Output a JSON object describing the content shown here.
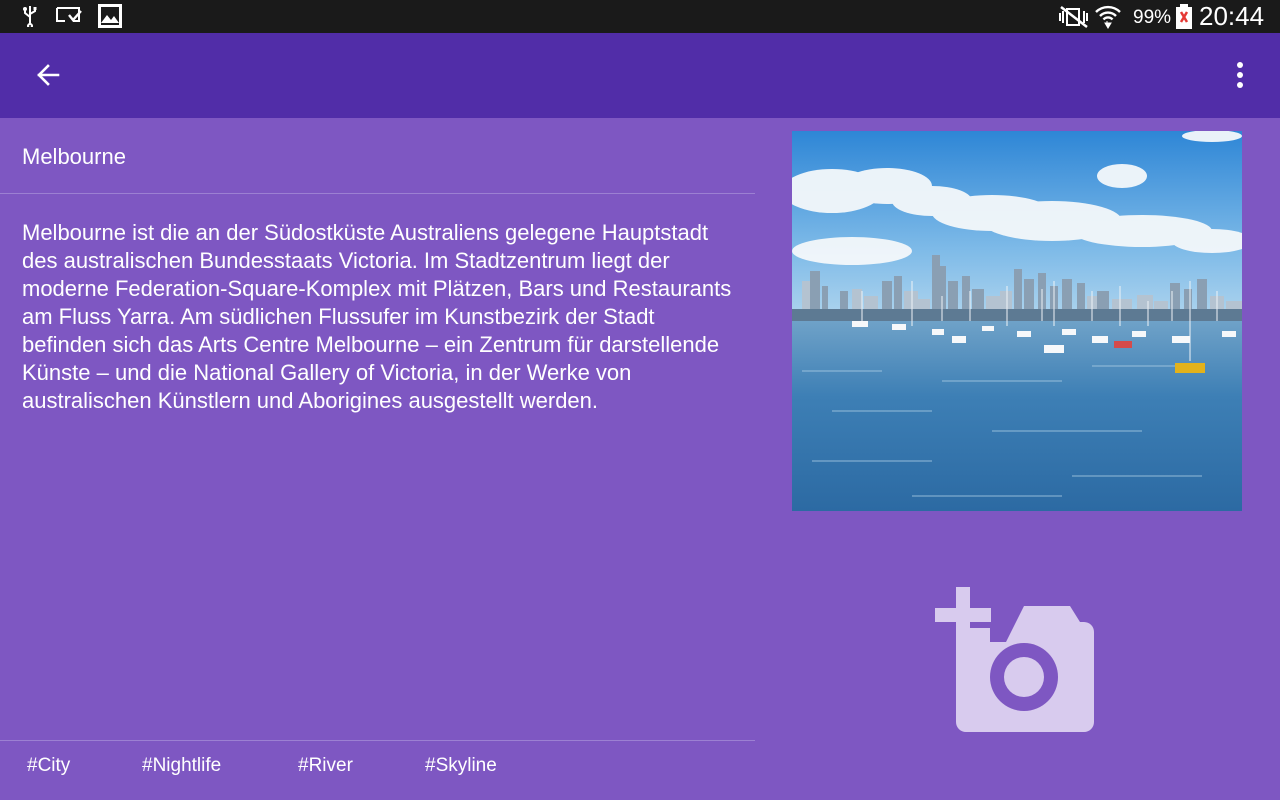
{
  "status_bar": {
    "battery_percent": "99%",
    "time": "20:44"
  },
  "place": {
    "title": "Melbourne",
    "description": "Melbourne ist die an der Südostküste Australiens gelegene Hauptstadt des australischen Bundesstaats Victoria. Im Stadtzentrum liegt der moderne Federation-Square-Komplex mit Plätzen, Bars und Restaurants am Fluss Yarra. Am südlichen Flussufer im Kunstbezirk der Stadt befinden sich das Arts Centre Melbourne – ein Zentrum für darstellende Künste – und die National Gallery of Victoria, in der Werke von australischen Künstlern und Aborigines ausgestellt werden."
  },
  "tags": [
    "#City",
    "#Nightlife",
    "#River",
    "#Skyline"
  ],
  "colors": {
    "status_bar": "#1a1a1a",
    "app_bar": "#512da8",
    "background": "#7e57c2",
    "add_photo_icon": "#d8cbee"
  },
  "icons": {
    "back": "arrow-left-icon",
    "overflow": "more-vert-icon",
    "add_photo": "add-a-photo-icon"
  }
}
